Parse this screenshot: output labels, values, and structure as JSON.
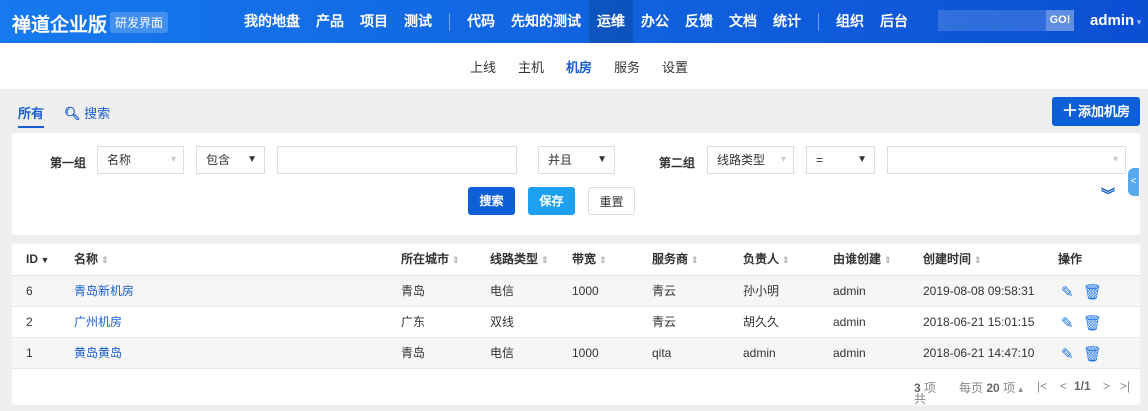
{
  "header": {
    "brand": "禅道企业版",
    "edition": "研发界面",
    "nav": [
      "我的地盘",
      "产品",
      "项目",
      "测试",
      "代码",
      "先知的测试",
      "运维",
      "办公",
      "反馈",
      "文档",
      "统计",
      "组织",
      "后台"
    ],
    "active_nav": "运维",
    "go": "GO!",
    "user": "admin"
  },
  "subnav": {
    "items": [
      "上线",
      "主机",
      "机房",
      "服务",
      "设置"
    ],
    "active": "机房"
  },
  "toolbar": {
    "all": "所有",
    "search": "搜索",
    "add": "添加机房"
  },
  "search": {
    "group1": "第一组",
    "field1": "名称",
    "op1": "包含",
    "value1": "",
    "andor": "并且",
    "group2": "第二组",
    "field2": "线路类型",
    "op2": "=",
    "value2": "",
    "search_btn": "搜索",
    "save_btn": "保存",
    "reset_btn": "重置"
  },
  "table": {
    "columns": [
      "ID",
      "名称",
      "所在城市",
      "线路类型",
      "带宽",
      "服务商",
      "负责人",
      "由谁创建",
      "创建时间",
      "操作"
    ],
    "rows": [
      {
        "id": "6",
        "name": "青岛新机房",
        "city": "青岛",
        "line": "电信",
        "bandwidth": "1000",
        "provider": "青云",
        "owner": "孙小明",
        "creator": "admin",
        "created": "2019-08-08 09:58:31"
      },
      {
        "id": "2",
        "name": "广州机房",
        "city": "广东",
        "line": "双线",
        "bandwidth": "",
        "provider": "青云",
        "owner": "胡久久",
        "creator": "admin",
        "created": "2018-06-21 15:01:15"
      },
      {
        "id": "1",
        "name": "黄岛黄岛",
        "city": "青岛",
        "line": "电信",
        "bandwidth": "1000",
        "provider": "qita",
        "owner": "admin",
        "creator": "admin",
        "created": "2018-06-21 14:47:10"
      }
    ]
  },
  "pager": {
    "total_prefix": "共",
    "total": "3",
    "total_suffix": "项",
    "per_prefix": "每页",
    "per": "20",
    "per_suffix": "项",
    "page": "1/1"
  }
}
